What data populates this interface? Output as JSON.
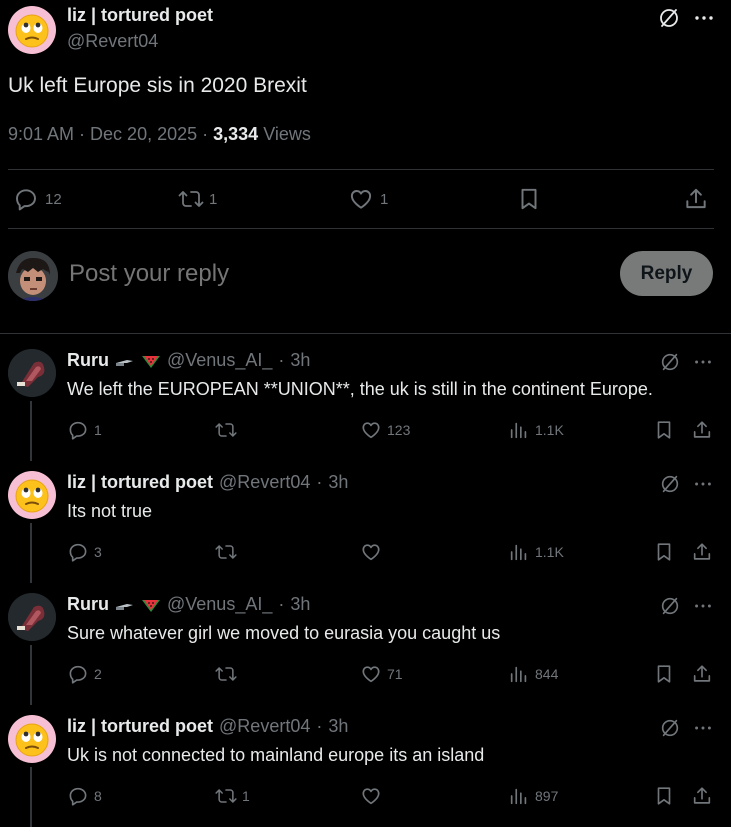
{
  "main_post": {
    "name": "liz | tortured poet",
    "handle": "@Revert04",
    "text": "Uk left Europe sis in 2020 Brexit",
    "time": "9:01 AM",
    "date": "Dec 20, 2025",
    "views_count": "3,334",
    "views_label": "Views",
    "replies": "12",
    "reposts": "1",
    "likes": "1"
  },
  "composer": {
    "placeholder": "Post your reply",
    "button": "Reply"
  },
  "replies": [
    {
      "name": "Ruru",
      "handle": "@Venus_AI_",
      "time": "3h",
      "text": "We left the EUROPEAN **UNION**, the uk is still in the continent Europe.",
      "replies": "1",
      "reposts": "",
      "likes": "123",
      "views": "1.1K"
    },
    {
      "name": "liz | tortured poet",
      "handle": "@Revert04",
      "time": "3h",
      "text": "Its not true",
      "replies": "3",
      "reposts": "",
      "likes": "",
      "views": "1.1K"
    },
    {
      "name": "Ruru",
      "handle": "@Venus_AI_",
      "time": "3h",
      "text": "Sure whatever girl we moved to eurasia you caught us",
      "replies": "2",
      "reposts": "",
      "likes": "71",
      "views": "844"
    },
    {
      "name": "liz | tortured poet",
      "handle": "@Revert04",
      "time": "3h",
      "text": "Uk is not connected to mainland europe its an island",
      "replies": "8",
      "reposts": "1",
      "likes": "",
      "views": "897"
    }
  ],
  "colors": {
    "background": "#000000",
    "text": "#e7e9ea",
    "muted": "#71767b",
    "reply_button": "#787a7a"
  },
  "icons": [
    "grok-icon",
    "more-icon",
    "reply-icon",
    "repost-icon",
    "like-icon",
    "bookmark-icon",
    "share-icon",
    "views-icon",
    "knife-emoji",
    "watermelon-emoji"
  ]
}
